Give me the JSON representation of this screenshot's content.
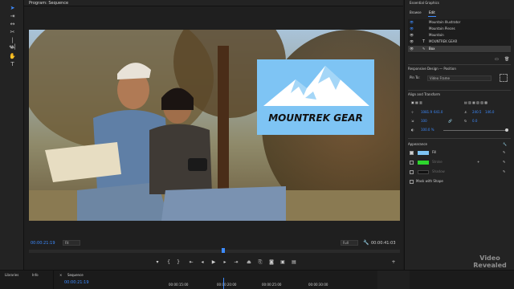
{
  "program_monitor": {
    "tab_title": "Program: Sequence",
    "timecode_current": "00:00:21:19",
    "fit": "Fit",
    "quality": "Full",
    "timecode_total": "00:00:41:03"
  },
  "overlay": {
    "logo_text": "MOUNTREK GEAR",
    "logo_bg": "#7ec4f4"
  },
  "essential_graphics": {
    "title": "Essential Graphics",
    "tabs": [
      "Browse",
      "Edit"
    ],
    "layers": [
      "Mountain Illustrator",
      "Mountain Pieces",
      "Mountain",
      "MOUNTREK GEAR",
      "Box"
    ],
    "responsive_design": "Responsive Design — Position",
    "pin_to_label": "Pin To:",
    "pin_to_value": "Video Frame",
    "align_transform": "Align and Transform",
    "position": [
      "1081.9",
      "641.0"
    ],
    "anchor": [
      "240.5",
      "146.0"
    ],
    "rotation": "0.0",
    "opacity": "100.0 %",
    "appearance": "Appearance",
    "fill_label": "Fill",
    "stroke_label": "Stroke",
    "shadow_label": "Shadow",
    "mask_label": "Mask with Shape",
    "colors": {
      "fill": "#7ec4f4",
      "stroke": "#2dd62d",
      "shadow": "#111111",
      "accent": "#3d8bff"
    }
  },
  "bottom": {
    "libraries": "Libraries",
    "info": "Info",
    "sequence_tab": "Sequence",
    "timecode": "00:00:21:19",
    "ruler": [
      "00:00:15:00",
      "00:00:20:00",
      "00:00:25:00",
      "00:00:30:00"
    ],
    "watermark_line1": "Video",
    "watermark_line2": "Revealed"
  }
}
